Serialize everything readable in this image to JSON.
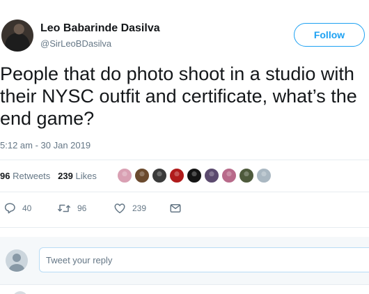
{
  "author": {
    "display_name": "Leo Babarinde Dasilva",
    "handle": "@SirLeoBDasilva"
  },
  "follow_button": {
    "label": "Follow"
  },
  "tweet": {
    "text": "People that do photo shoot in a studio with\ntheir NYSC outfit and certificate, what’s the\nend game?",
    "timestamp": "5:12 am - 30 Jan 2019"
  },
  "stats": {
    "retweets_count": "96",
    "retweets_label": "Retweets",
    "likes_count": "239",
    "likes_label": "Likes"
  },
  "likers": [
    {
      "color": "#d9a0b3"
    },
    {
      "color": "#6b4a2e"
    },
    {
      "color": "#3a3a3a"
    },
    {
      "color": "#b01b1b"
    },
    {
      "color": "#141414"
    },
    {
      "color": "#5b4a6e"
    },
    {
      "color": "#b86a8a"
    },
    {
      "color": "#4e5a3c"
    },
    {
      "color": "#aab8c2"
    }
  ],
  "actions": {
    "reply_count": "40",
    "retweet_count": "96",
    "like_count": "239",
    "reply_icon": "reply-icon",
    "retweet_icon": "retweet-icon",
    "like_icon": "heart-icon",
    "dm_icon": "envelope-icon"
  },
  "reply_box": {
    "placeholder": "Tweet your reply"
  },
  "colors": {
    "accent": "#1da1f2",
    "text": "#14171a",
    "muted": "#657786",
    "divider": "#e6ecf0",
    "reply_bg": "#f5f8fa"
  }
}
